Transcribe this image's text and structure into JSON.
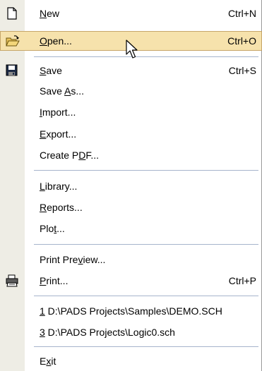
{
  "menu": {
    "items": [
      {
        "id": "new",
        "pre": "",
        "u": "N",
        "post": "ew",
        "shortcut": "Ctrl+N",
        "icon": "new-document-icon"
      },
      {
        "id": "open",
        "pre": "",
        "u": "O",
        "post": "pen...",
        "shortcut": "Ctrl+O",
        "icon": "open-folder-icon",
        "highlighted": true
      },
      {
        "id": "save",
        "pre": "",
        "u": "S",
        "post": "ave",
        "shortcut": "Ctrl+S",
        "icon": "save-disk-icon"
      },
      {
        "id": "save-as",
        "pre": "Save ",
        "u": "A",
        "post": "s...",
        "shortcut": ""
      },
      {
        "id": "import",
        "pre": "",
        "u": "I",
        "post": "mport...",
        "shortcut": ""
      },
      {
        "id": "export",
        "pre": "",
        "u": "E",
        "post": "xport...",
        "shortcut": ""
      },
      {
        "id": "create-pdf",
        "pre": "Create P",
        "u": "D",
        "post": "F...",
        "shortcut": ""
      },
      {
        "id": "library",
        "pre": "",
        "u": "L",
        "post": "ibrary...",
        "shortcut": ""
      },
      {
        "id": "reports",
        "pre": "",
        "u": "R",
        "post": "eports...",
        "shortcut": ""
      },
      {
        "id": "plot",
        "pre": "Plo",
        "u": "t",
        "post": "...",
        "shortcut": ""
      },
      {
        "id": "print-preview",
        "pre": "Print Pre",
        "u": "v",
        "post": "iew...",
        "shortcut": ""
      },
      {
        "id": "print",
        "pre": "",
        "u": "P",
        "post": "rint...",
        "shortcut": "Ctrl+P",
        "icon": "printer-icon"
      },
      {
        "id": "recent-1",
        "pre": "",
        "u": "1",
        "post": " D:\\PADS Projects\\Samples\\DEMO.SCH",
        "shortcut": ""
      },
      {
        "id": "recent-3",
        "pre": "",
        "u": "3",
        "post": " D:\\PADS Projects\\Logic0.sch",
        "shortcut": ""
      },
      {
        "id": "exit",
        "pre": "E",
        "u": "x",
        "post": "it",
        "shortcut": ""
      }
    ]
  },
  "colors": {
    "highlight_bg": "#f6e2ac",
    "highlight_border": "#c6a66a",
    "gutter": "#eeede5",
    "separator": "#a6b4cc"
  }
}
